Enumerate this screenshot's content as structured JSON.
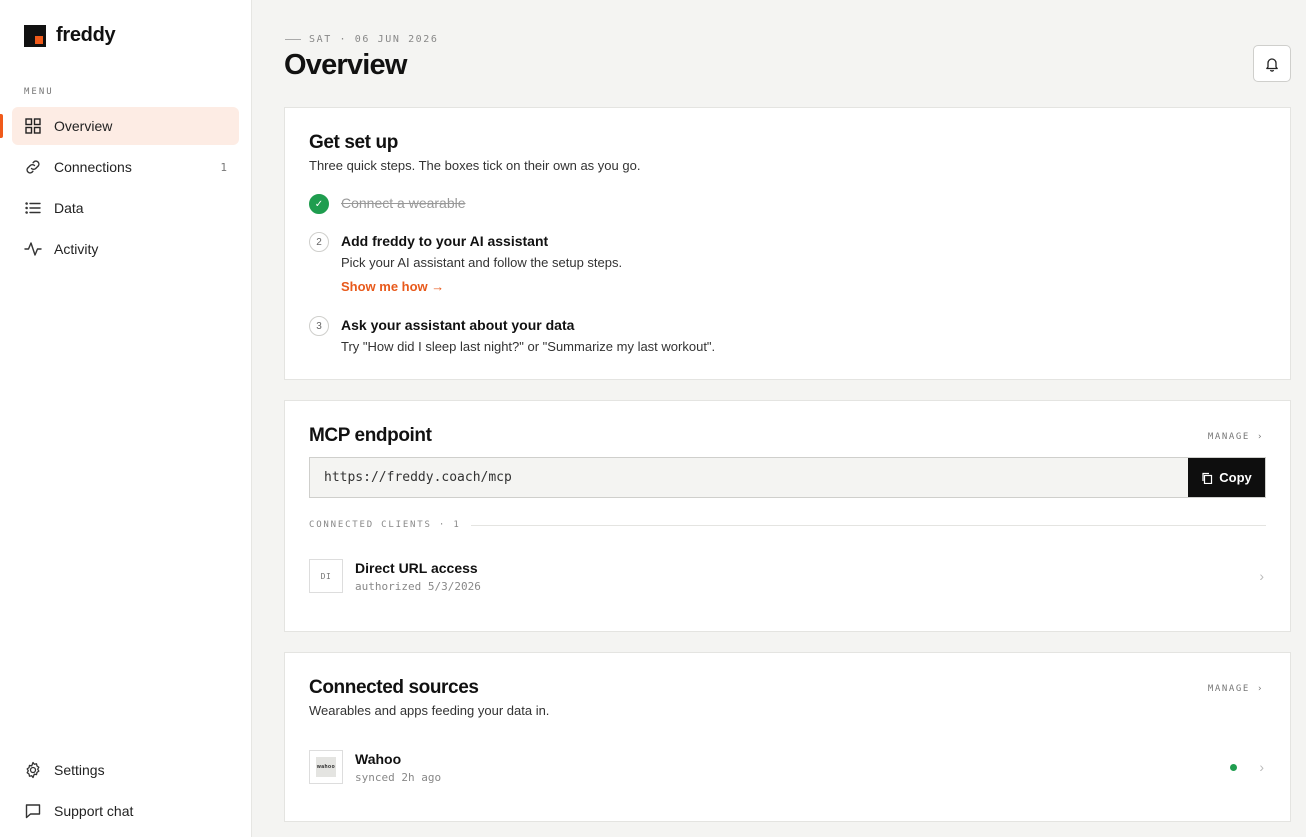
{
  "app": {
    "name": "freddy"
  },
  "sidebar": {
    "menu_label": "MENU",
    "items": [
      {
        "label": "Overview",
        "icon": "grid-icon",
        "active": true
      },
      {
        "label": "Connections",
        "icon": "link-icon",
        "count": "1"
      },
      {
        "label": "Data",
        "icon": "list-icon"
      },
      {
        "label": "Activity",
        "icon": "activity-icon"
      }
    ],
    "bottom_items": [
      {
        "label": "Settings",
        "icon": "gear-icon"
      },
      {
        "label": "Support chat",
        "icon": "chat-icon"
      }
    ]
  },
  "header": {
    "date": "SAT · 06 JUN 2026",
    "title": "Overview",
    "bell_icon": "bell-icon"
  },
  "setup": {
    "title": "Get set up",
    "subtitle": "Three quick steps. The boxes tick on their own as you go.",
    "steps": [
      {
        "marker": "✓",
        "title": "Connect a wearable",
        "done": true
      },
      {
        "marker": "2",
        "title": "Add freddy to your AI assistant",
        "desc": "Pick your AI assistant and follow the setup steps.",
        "link": "Show me how →"
      },
      {
        "marker": "3",
        "title": "Ask your assistant about your data",
        "desc": "Try \"How did I sleep last night?\" or \"Summarize my last workout\"."
      }
    ]
  },
  "mcp": {
    "title": "MCP endpoint",
    "manage_label": "MANAGE ›",
    "url": "https://freddy.coach/mcp",
    "copy_label": "Copy",
    "clients_label": "CONNECTED CLIENTS · 1",
    "clients": [
      {
        "badge": "DI",
        "name": "Direct URL access",
        "meta": "authorized 5/3/2026"
      }
    ]
  },
  "sources": {
    "title": "Connected sources",
    "manage_label": "MANAGE ›",
    "subtitle": "Wearables and apps feeding your data in.",
    "items": [
      {
        "logo_text": "wahoo",
        "name": "Wahoo",
        "meta": "synced 2h ago",
        "status_color": "#1f9d4f"
      }
    ]
  },
  "colors": {
    "accent": "#f05a1a",
    "success": "#1f9d4f"
  }
}
